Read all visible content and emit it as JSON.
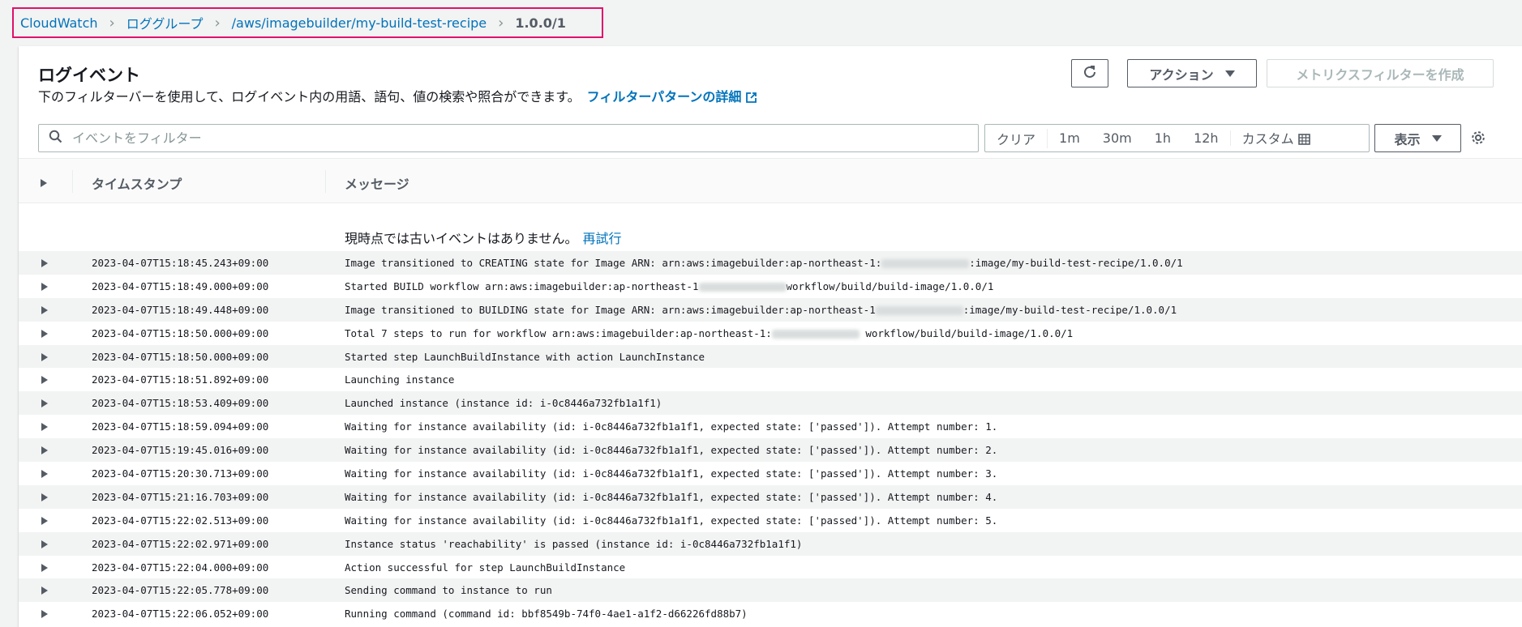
{
  "breadcrumb": {
    "items": [
      "CloudWatch",
      "ロググループ",
      "/aws/imagebuilder/my-build-test-recipe"
    ],
    "current": "1.0.0/1"
  },
  "panel": {
    "title": "ログイベント",
    "description": "下のフィルターバーを使用して、ログイベント内の用語、語句、値の検索や照合ができます。",
    "filter_link": "フィルターパターンの詳細",
    "actions_label": "アクション",
    "metric_filter_label": "メトリクスフィルターを作成"
  },
  "search": {
    "placeholder": "イベントをフィルター",
    "value": ""
  },
  "time_range": {
    "clear": "クリア",
    "options": [
      "1m",
      "30m",
      "1h",
      "12h"
    ],
    "custom": "カスタム"
  },
  "display_label": "表示",
  "table": {
    "col_timestamp": "タイムスタンプ",
    "col_message": "メッセージ",
    "notice": "現時点では古いイベントはありません。",
    "retry": "再試行",
    "rows": [
      {
        "ts": "2023-04-07T15:18:45.243+09:00",
        "pre": "Image transitioned to CREATING state for Image ARN: arn:aws:imagebuilder:ap-northeast-1:",
        "post": ":image/my-build-test-recipe/1.0.0/1",
        "redacted": true
      },
      {
        "ts": "2023-04-07T15:18:49.000+09:00",
        "pre": "Started BUILD workflow arn:aws:imagebuilder:ap-northeast-1",
        "post": "workflow/build/build-image/1.0.0/1",
        "redacted": true
      },
      {
        "ts": "2023-04-07T15:18:49.448+09:00",
        "pre": "Image transitioned to BUILDING state for Image ARN: arn:aws:imagebuilder:ap-northeast-1",
        "post": ":image/my-build-test-recipe/1.0.0/1",
        "redacted": true
      },
      {
        "ts": "2023-04-07T15:18:50.000+09:00",
        "pre": "Total 7 steps to run for workflow arn:aws:imagebuilder:ap-northeast-1:",
        "post": " workflow/build/build-image/1.0.0/1",
        "redacted": true
      },
      {
        "ts": "2023-04-07T15:18:50.000+09:00",
        "pre": "Started step LaunchBuildInstance with action LaunchInstance",
        "post": "",
        "redacted": false
      },
      {
        "ts": "2023-04-07T15:18:51.892+09:00",
        "pre": "Launching instance",
        "post": "",
        "redacted": false
      },
      {
        "ts": "2023-04-07T15:18:53.409+09:00",
        "pre": "Launched instance (instance id: i-0c8446a732fb1a1f1)",
        "post": "",
        "redacted": false
      },
      {
        "ts": "2023-04-07T15:18:59.094+09:00",
        "pre": "Waiting for instance availability (id: i-0c8446a732fb1a1f1, expected state: ['passed']). Attempt number: 1.",
        "post": "",
        "redacted": false
      },
      {
        "ts": "2023-04-07T15:19:45.016+09:00",
        "pre": "Waiting for instance availability (id: i-0c8446a732fb1a1f1, expected state: ['passed']). Attempt number: 2.",
        "post": "",
        "redacted": false
      },
      {
        "ts": "2023-04-07T15:20:30.713+09:00",
        "pre": "Waiting for instance availability (id: i-0c8446a732fb1a1f1, expected state: ['passed']). Attempt number: 3.",
        "post": "",
        "redacted": false
      },
      {
        "ts": "2023-04-07T15:21:16.703+09:00",
        "pre": "Waiting for instance availability (id: i-0c8446a732fb1a1f1, expected state: ['passed']). Attempt number: 4.",
        "post": "",
        "redacted": false
      },
      {
        "ts": "2023-04-07T15:22:02.513+09:00",
        "pre": "Waiting for instance availability (id: i-0c8446a732fb1a1f1, expected state: ['passed']). Attempt number: 5.",
        "post": "",
        "redacted": false
      },
      {
        "ts": "2023-04-07T15:22:02.971+09:00",
        "pre": "Instance status 'reachability' is passed (instance id: i-0c8446a732fb1a1f1)",
        "post": "",
        "redacted": false
      },
      {
        "ts": "2023-04-07T15:22:04.000+09:00",
        "pre": "Action successful for step LaunchBuildInstance",
        "post": "",
        "redacted": false
      },
      {
        "ts": "2023-04-07T15:22:05.778+09:00",
        "pre": "Sending command to instance to run",
        "post": "",
        "redacted": false
      },
      {
        "ts": "2023-04-07T15:22:06.052+09:00",
        "pre": "Running command (command id: bbf8549b-74f0-4ae1-a1f2-d66226fd88b7)",
        "post": "",
        "redacted": false
      }
    ]
  },
  "colors": {
    "link": "#0073bb",
    "highlight_border": "#e0116b",
    "stripe": "#f2f3f3"
  }
}
